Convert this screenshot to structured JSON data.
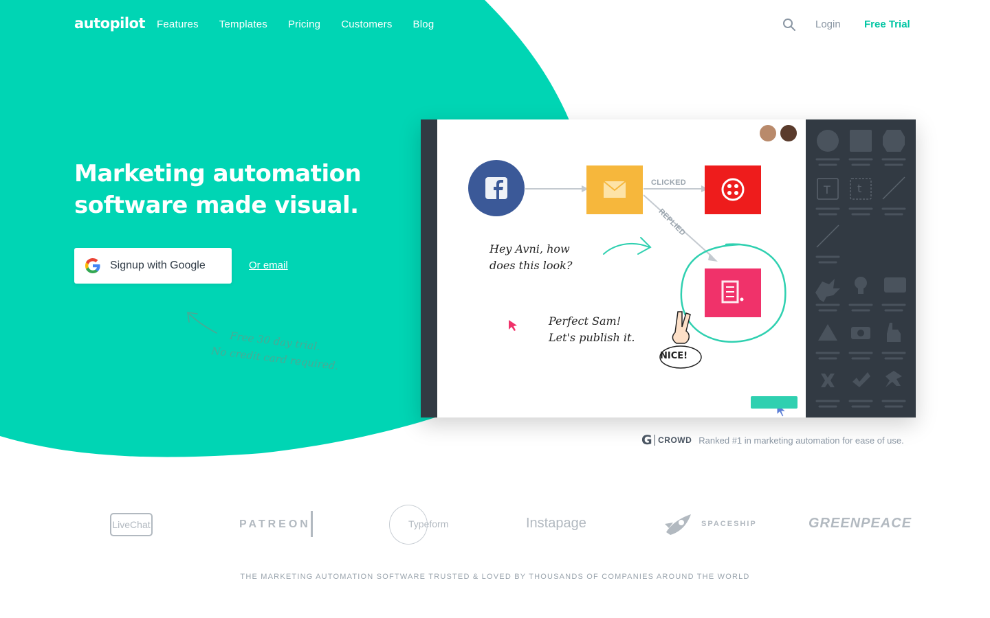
{
  "nav": {
    "logo": "autopilot",
    "links": [
      "Features",
      "Templates",
      "Pricing",
      "Customers",
      "Blog"
    ],
    "login": "Login",
    "free_trial": "Free Trial"
  },
  "hero": {
    "title": "Marketing automation software made visual.",
    "google_button": "Signup with Google",
    "or_email": "Or email",
    "trial_note_line1": "Free 30 day trial.",
    "trial_note_line2": "No credit card required."
  },
  "mockup": {
    "label_clicked": "CLICKED",
    "label_replied": "REPLIED",
    "note1_line1": "Hey Avni, how",
    "note1_line2": "does this look?",
    "note2_line1": "Perfect Sam!",
    "note2_line2": "Let's publish it.",
    "badge": "NICE!"
  },
  "g2": {
    "logo_text": "CROWD",
    "ranked": "Ranked #1 in marketing automation for ease of use."
  },
  "logos": {
    "livechat": "LiveChat",
    "patreon": "PATREON",
    "typeform": "Typeform",
    "instapage": "Instapage",
    "spaceship": "SPACESHIP",
    "greenpeace": "GREENPEACE"
  },
  "trusted": "THE MARKETING AUTOMATION SOFTWARE TRUSTED & LOVED BY THOUSANDS OF COMPANIES AROUND THE WORLD",
  "colors": {
    "brand_teal": "#00d5b4",
    "free_trial": "#00c5a3",
    "facebook": "#3b5998",
    "email": "#f6b73c",
    "twilio": "#ee1c1c",
    "form": "#f0326a",
    "sidebar": "#323a43"
  }
}
